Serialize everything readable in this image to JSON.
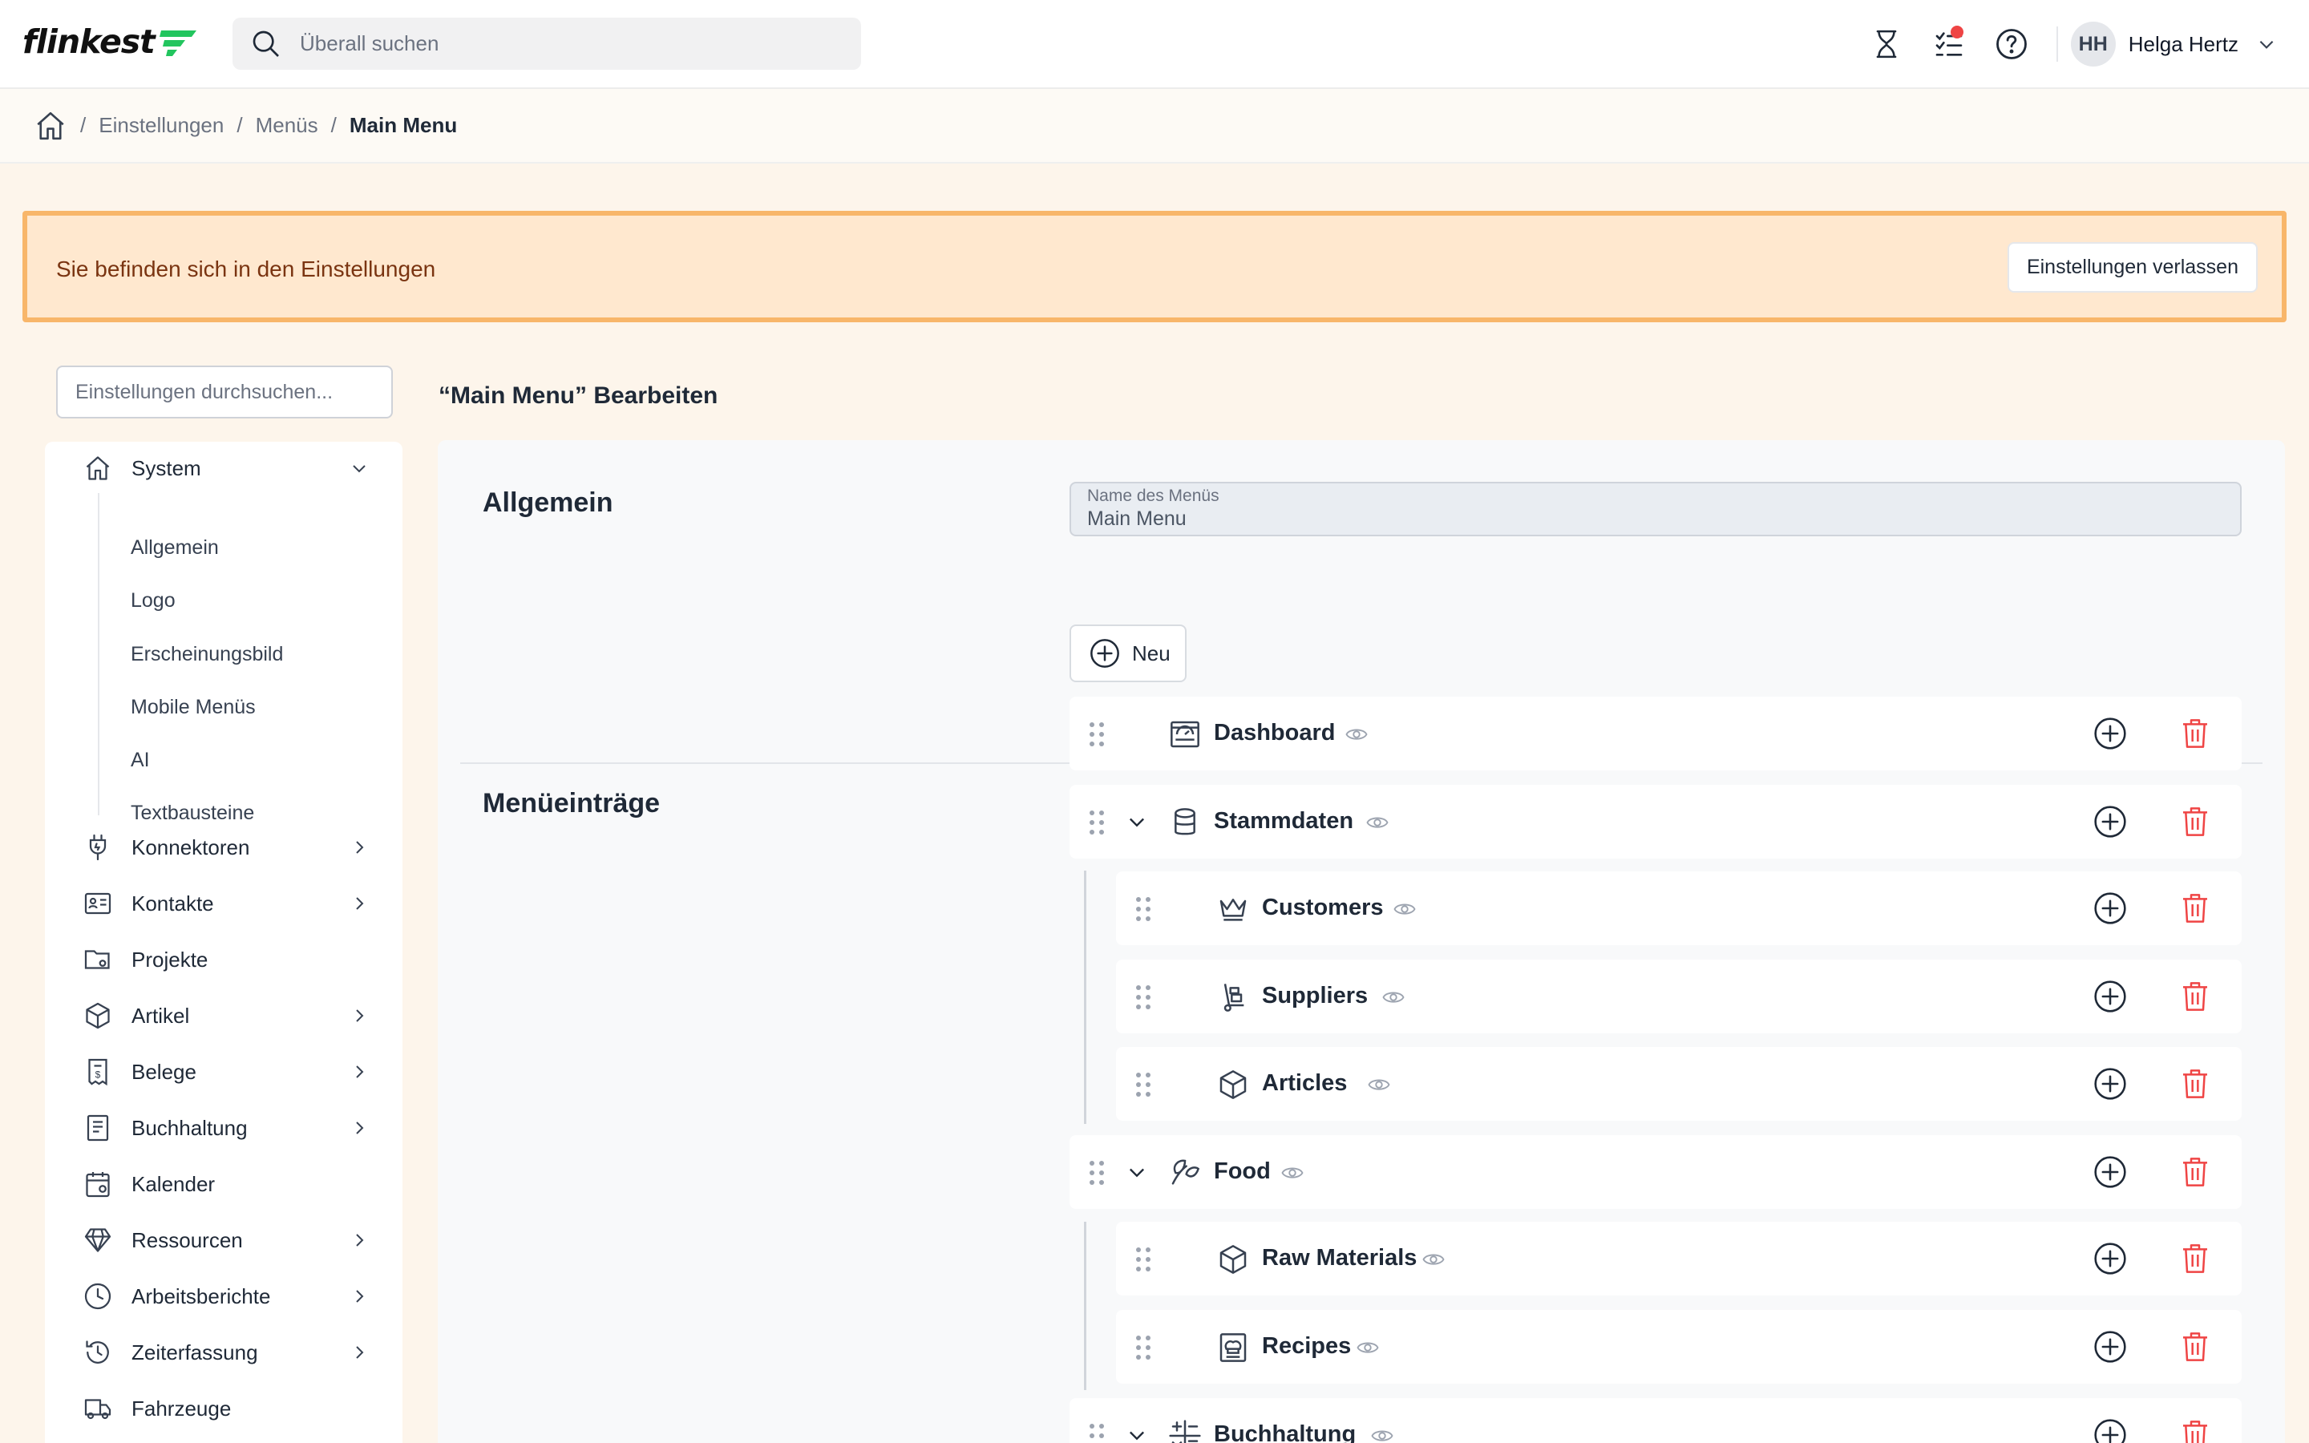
{
  "app": {
    "logo_text": "flinkest",
    "brand_color": "#22c55e"
  },
  "search": {
    "placeholder": "Überall suchen"
  },
  "user": {
    "initials": "HH",
    "name": "Helga Hertz"
  },
  "header_icons": [
    "hourglass-icon",
    "checklist-icon",
    "help-icon"
  ],
  "breadcrumb": {
    "items": [
      "Einstellungen",
      "Menüs"
    ],
    "current": "Main Menu"
  },
  "banner": {
    "text": "Sie befinden sich in den Einstellungen",
    "button": "Einstellungen verlassen"
  },
  "settings_search": {
    "placeholder": "Einstellungen durchsuchen..."
  },
  "sidebar": {
    "items": [
      {
        "label": "System",
        "icon": "home-icon",
        "expanded": true
      },
      {
        "label": "Konnektoren",
        "icon": "plug-icon",
        "has_children": true
      },
      {
        "label": "Kontakte",
        "icon": "contact-card-icon",
        "has_children": true
      },
      {
        "label": "Projekte",
        "icon": "folder-gear-icon",
        "has_children": false
      },
      {
        "label": "Artikel",
        "icon": "box-icon",
        "has_children": true
      },
      {
        "label": "Belege",
        "icon": "receipt-icon",
        "has_children": true
      },
      {
        "label": "Buchhaltung",
        "icon": "ledger-icon",
        "has_children": true
      },
      {
        "label": "Kalender",
        "icon": "calendar-icon",
        "has_children": false
      },
      {
        "label": "Ressourcen",
        "icon": "diamond-icon",
        "has_children": true
      },
      {
        "label": "Arbeitsberichte",
        "icon": "clock-icon",
        "has_children": true
      },
      {
        "label": "Zeiterfassung",
        "icon": "history-icon",
        "has_children": true
      },
      {
        "label": "Fahrzeuge",
        "icon": "truck-icon",
        "has_children": false
      }
    ],
    "system_children": [
      "Allgemein",
      "Logo",
      "Erscheinungsbild",
      "Mobile Menüs",
      "AI",
      "Textbausteine"
    ]
  },
  "page": {
    "title": "“Main Menu”  Bearbeiten"
  },
  "general": {
    "title": "Allgemein",
    "field_label": "Name des Menüs",
    "field_value": "Main Menu"
  },
  "entries": {
    "title": "Menüeinträge",
    "new_button": "Neu",
    "items": [
      {
        "label": "Dashboard",
        "icon": "dashboard-icon",
        "level": 0
      },
      {
        "label": "Stammdaten",
        "icon": "database-icon",
        "level": 0,
        "expandable": true
      },
      {
        "label": "Customers",
        "icon": "crown-icon",
        "level": 1
      },
      {
        "label": "Suppliers",
        "icon": "hand-truck-icon",
        "level": 1
      },
      {
        "label": "Articles",
        "icon": "box-icon",
        "level": 1
      },
      {
        "label": "Food",
        "icon": "leaf-icon",
        "level": 0,
        "expandable": true
      },
      {
        "label": "Raw Materials",
        "icon": "box-icon",
        "level": 1
      },
      {
        "label": "Recipes",
        "icon": "recipe-book-icon",
        "level": 1
      },
      {
        "label": "Buchhaltung",
        "icon": "calculator-icon",
        "level": 0,
        "expandable": true
      }
    ]
  },
  "colors": {
    "banner_bg": "#ffe8cf",
    "banner_border": "#f8b66a",
    "delete_red": "#ef4444",
    "page_bg": "#fdf5eb"
  }
}
